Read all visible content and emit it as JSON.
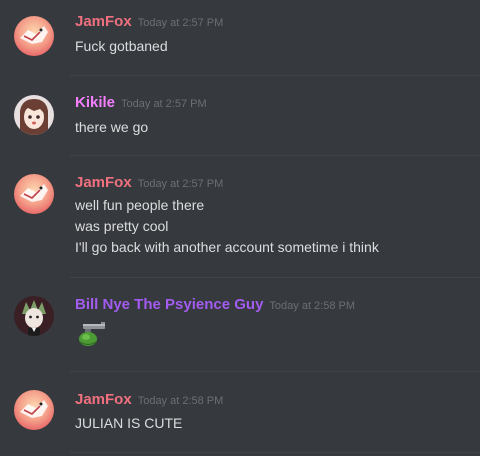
{
  "messages": [
    {
      "author": "JamFox",
      "author_color": "#f0707f",
      "avatar": "jamfox-avatar",
      "timestamp": "Today at 2:57 PM",
      "lines": [
        "Fuck gotbaned"
      ]
    },
    {
      "author": "Kikile",
      "author_color": "#f47fff",
      "avatar": "kikile-avatar",
      "timestamp": "Today at 2:57 PM",
      "lines": [
        "there we go"
      ]
    },
    {
      "author": "JamFox",
      "author_color": "#f0707f",
      "avatar": "jamfox-avatar",
      "timestamp": "Today at 2:57 PM",
      "lines": [
        "well fun people there",
        "was pretty cool",
        "I'll go back with another account sometime i think"
      ]
    },
    {
      "author": "Bill Nye The Psyience Guy",
      "author_color": "#a35cf0",
      "avatar": "bill-nye-avatar",
      "timestamp": "Today at 2:58 PM",
      "emoji": "gun-emoji"
    },
    {
      "author": "JamFox",
      "author_color": "#f0707f",
      "avatar": "jamfox-avatar",
      "timestamp": "Today at 2:58 PM",
      "lines": [
        "JULIAN IS CUTE"
      ]
    }
  ]
}
